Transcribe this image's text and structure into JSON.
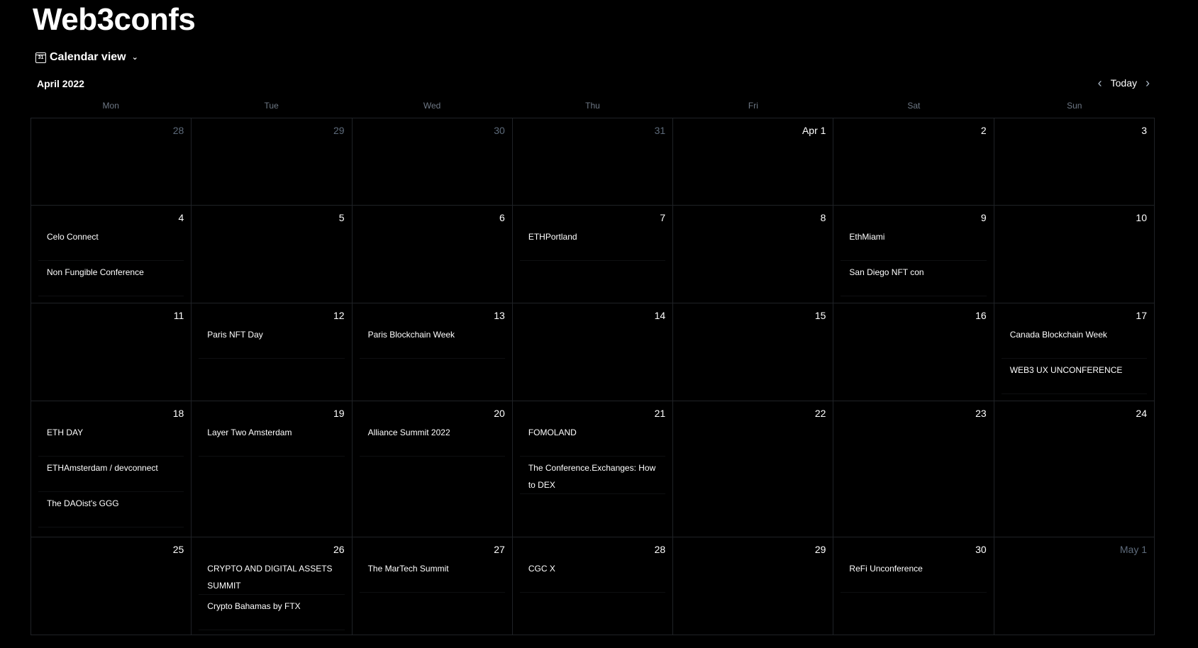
{
  "app": {
    "title": "Web3confs"
  },
  "view_switch": {
    "icon_label": "31",
    "label": "Calendar view"
  },
  "calendar": {
    "month_label": "April 2022",
    "today_label": "Today",
    "weekdays": [
      "Mon",
      "Tue",
      "Wed",
      "Thu",
      "Fri",
      "Sat",
      "Sun"
    ],
    "weeks": [
      {
        "days": [
          {
            "label": "28",
            "muted": true,
            "events": []
          },
          {
            "label": "29",
            "muted": true,
            "events": []
          },
          {
            "label": "30",
            "muted": true,
            "events": []
          },
          {
            "label": "31",
            "muted": true,
            "events": []
          },
          {
            "label": "Apr 1",
            "muted": false,
            "events": []
          },
          {
            "label": "2",
            "muted": false,
            "events": []
          },
          {
            "label": "3",
            "muted": false,
            "events": []
          }
        ]
      },
      {
        "days": [
          {
            "label": "4",
            "muted": false,
            "events": [
              "Celo Connect",
              "Non Fungible Conference"
            ]
          },
          {
            "label": "5",
            "muted": false,
            "events": []
          },
          {
            "label": "6",
            "muted": false,
            "events": []
          },
          {
            "label": "7",
            "muted": false,
            "events": [
              "ETHPortland"
            ]
          },
          {
            "label": "8",
            "muted": false,
            "events": []
          },
          {
            "label": "9",
            "muted": false,
            "events": [
              "EthMiami",
              "San Diego NFT con"
            ]
          },
          {
            "label": "10",
            "muted": false,
            "events": []
          }
        ]
      },
      {
        "days": [
          {
            "label": "11",
            "muted": false,
            "events": []
          },
          {
            "label": "12",
            "muted": false,
            "events": [
              "Paris NFT Day"
            ]
          },
          {
            "label": "13",
            "muted": false,
            "events": [
              "Paris Blockchain Week"
            ]
          },
          {
            "label": "14",
            "muted": false,
            "events": []
          },
          {
            "label": "15",
            "muted": false,
            "events": []
          },
          {
            "label": "16",
            "muted": false,
            "events": []
          },
          {
            "label": "17",
            "muted": false,
            "events": [
              "Canada Blockchain Week",
              "WEB3 UX UNCONFERENCE"
            ]
          }
        ]
      },
      {
        "days": [
          {
            "label": "18",
            "muted": false,
            "events": [
              "ETH DAY",
              "ETHAmsterdam / devconnect",
              "The DAOist's GGG"
            ]
          },
          {
            "label": "19",
            "muted": false,
            "events": [
              "Layer Two Amsterdam"
            ]
          },
          {
            "label": "20",
            "muted": false,
            "events": [
              "Alliance Summit 2022"
            ]
          },
          {
            "label": "21",
            "muted": false,
            "events": [
              "FOMOLAND",
              "The Conference.Exchanges: How to DEX"
            ]
          },
          {
            "label": "22",
            "muted": false,
            "events": []
          },
          {
            "label": "23",
            "muted": false,
            "events": []
          },
          {
            "label": "24",
            "muted": false,
            "events": []
          }
        ]
      },
      {
        "days": [
          {
            "label": "25",
            "muted": false,
            "events": []
          },
          {
            "label": "26",
            "muted": false,
            "events": [
              "CRYPTO AND DIGITAL ASSETS SUMMIT",
              "Crypto Bahamas by FTX"
            ]
          },
          {
            "label": "27",
            "muted": false,
            "events": [
              "The MarTech Summit"
            ]
          },
          {
            "label": "28",
            "muted": false,
            "events": [
              "CGC X"
            ]
          },
          {
            "label": "29",
            "muted": false,
            "events": []
          },
          {
            "label": "30",
            "muted": false,
            "events": [
              "ReFi Unconference"
            ]
          },
          {
            "label": "May 1",
            "muted": true,
            "events": []
          }
        ]
      }
    ]
  },
  "colors": {
    "background": "#000000",
    "text": "#ffffff",
    "muted_day": "#5d6a7a",
    "weekday": "#6e7885",
    "grid_line": "#1f2226"
  }
}
